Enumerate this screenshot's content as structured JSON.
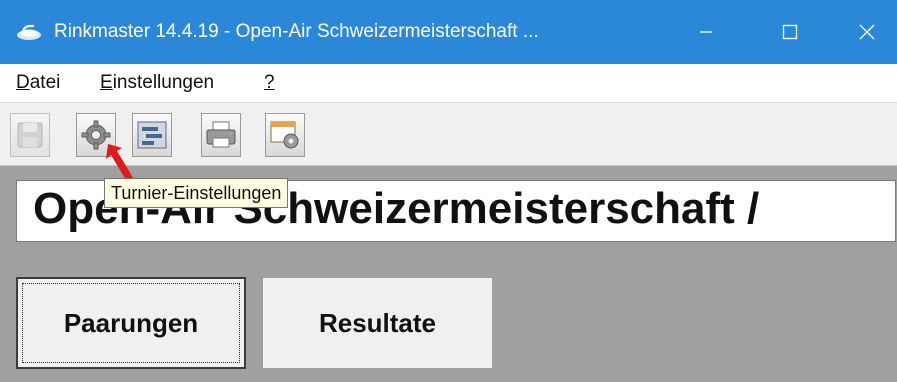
{
  "window": {
    "title": "Rinkmaster 14.4.19 - Open-Air Schweizermeisterschaft ...",
    "title_bar_color": "#2b88d8"
  },
  "menu": {
    "items": [
      {
        "label": "Datei",
        "accel": "D",
        "rest": "atei"
      },
      {
        "label": "Einstellungen",
        "accel": "E",
        "rest": "instellungen"
      },
      {
        "label": "?",
        "accel": "?",
        "rest": ""
      }
    ]
  },
  "toolbar": {
    "buttons": [
      {
        "icon": "save-icon",
        "enabled": false
      },
      {
        "icon": "gear-settings-icon",
        "enabled": true
      },
      {
        "icon": "list-icon",
        "enabled": true
      },
      {
        "icon": "printer-icon",
        "enabled": true
      },
      {
        "icon": "window-settings-icon",
        "enabled": true
      }
    ]
  },
  "tooltip": {
    "text": "Turnier-Einstellungen"
  },
  "tournament": {
    "title": "Open-Air Schweizermeisterschaft /"
  },
  "buttons": {
    "pairings": "Paarungen",
    "results": "Resultate"
  },
  "annotation": {
    "arrow_color": "#e01b1b"
  }
}
